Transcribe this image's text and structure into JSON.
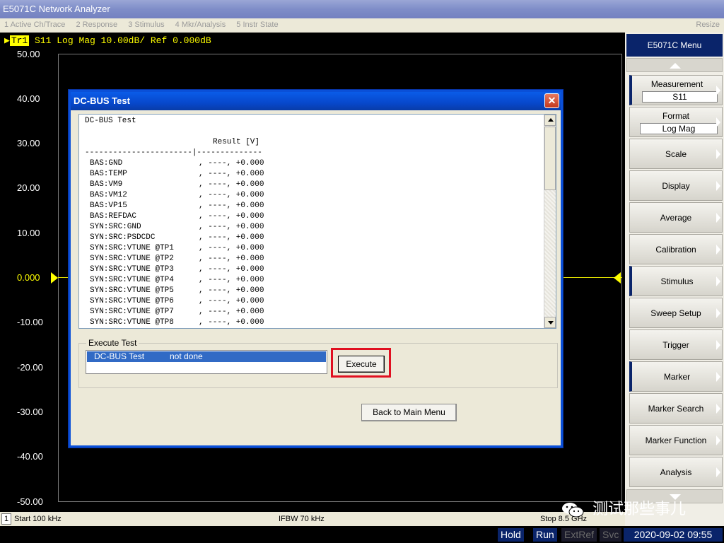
{
  "window": {
    "title": "E5071C Network Analyzer"
  },
  "menu": {
    "items": [
      "1 Active Ch/Trace",
      "2 Response",
      "3 Stimulus",
      "4 Mkr/Analysis",
      "5 Instr State"
    ],
    "resize": "Resize"
  },
  "trace": {
    "badge": "Tr1",
    "header": "S11 Log Mag 10.00dB/ Ref 0.000dB",
    "yticks": [
      "50.00",
      "40.00",
      "30.00",
      "20.00",
      "10.00",
      "0.000",
      "-10.00",
      "-20.00",
      "-30.00",
      "-40.00",
      "-50.00"
    ]
  },
  "stimulus": {
    "channel": "1",
    "start": "Start 100 kHz",
    "ifbw": "IFBW 70 kHz",
    "stop": "Stop 8.5 GHz"
  },
  "status": {
    "hold": "Hold",
    "run": "Run",
    "extref": "ExtRef",
    "svc": "Svc",
    "clock": "2020-09-02 09:55"
  },
  "softkeys": {
    "title": "E5071C Menu",
    "measurement": {
      "label": "Measurement",
      "value": "S11"
    },
    "format": {
      "label": "Format",
      "value": "Log Mag"
    },
    "items": [
      "Scale",
      "Display",
      "Average",
      "Calibration",
      "Stimulus",
      "Sweep Setup",
      "Trigger",
      "Marker",
      "Marker Search",
      "Marker Function",
      "Analysis"
    ]
  },
  "dialog": {
    "title": "DC-BUS Test",
    "close": "✕",
    "log_title": "DC-BUS Test",
    "result_header": "Result [V]",
    "separator": "-----------------------|--------------",
    "rows": [
      {
        "name": "BAS:GND",
        "value": ", ----, +0.000"
      },
      {
        "name": "BAS:TEMP",
        "value": ", ----, +0.000"
      },
      {
        "name": "BAS:VM9",
        "value": ", ----, +0.000"
      },
      {
        "name": "BAS:VM12",
        "value": ", ----, +0.000"
      },
      {
        "name": "BAS:VP15",
        "value": ", ----, +0.000"
      },
      {
        "name": "BAS:REFDAC",
        "value": ", ----, +0.000"
      },
      {
        "name": "SYN:SRC:GND",
        "value": ", ----, +0.000"
      },
      {
        "name": "SYN:SRC:PSDCDC",
        "value": ", ----, +0.000"
      },
      {
        "name": "SYN:SRC:VTUNE @TP1",
        "value": ", ----, +0.000"
      },
      {
        "name": "SYN:SRC:VTUNE @TP2",
        "value": ", ----, +0.000"
      },
      {
        "name": "SYN:SRC:VTUNE @TP3",
        "value": ", ----, +0.000"
      },
      {
        "name": "SYN:SRC:VTUNE @TP4",
        "value": ", ----, +0.000"
      },
      {
        "name": "SYN:SRC:VTUNE @TP5",
        "value": ", ----, +0.000"
      },
      {
        "name": "SYN:SRC:VTUNE @TP6",
        "value": ", ----, +0.000"
      },
      {
        "name": "SYN:SRC:VTUNE @TP7",
        "value": ", ----, +0.000"
      },
      {
        "name": "SYN:SRC:VTUNE @TP8",
        "value": ", ----, +0.000"
      }
    ],
    "execute_group": "Execute Test",
    "test": {
      "name": "DC-BUS Test",
      "state": "not done"
    },
    "execute_button": "Execute",
    "back_button": "Back to Main Menu"
  },
  "watermark": {
    "text": "测试那些事儿"
  }
}
